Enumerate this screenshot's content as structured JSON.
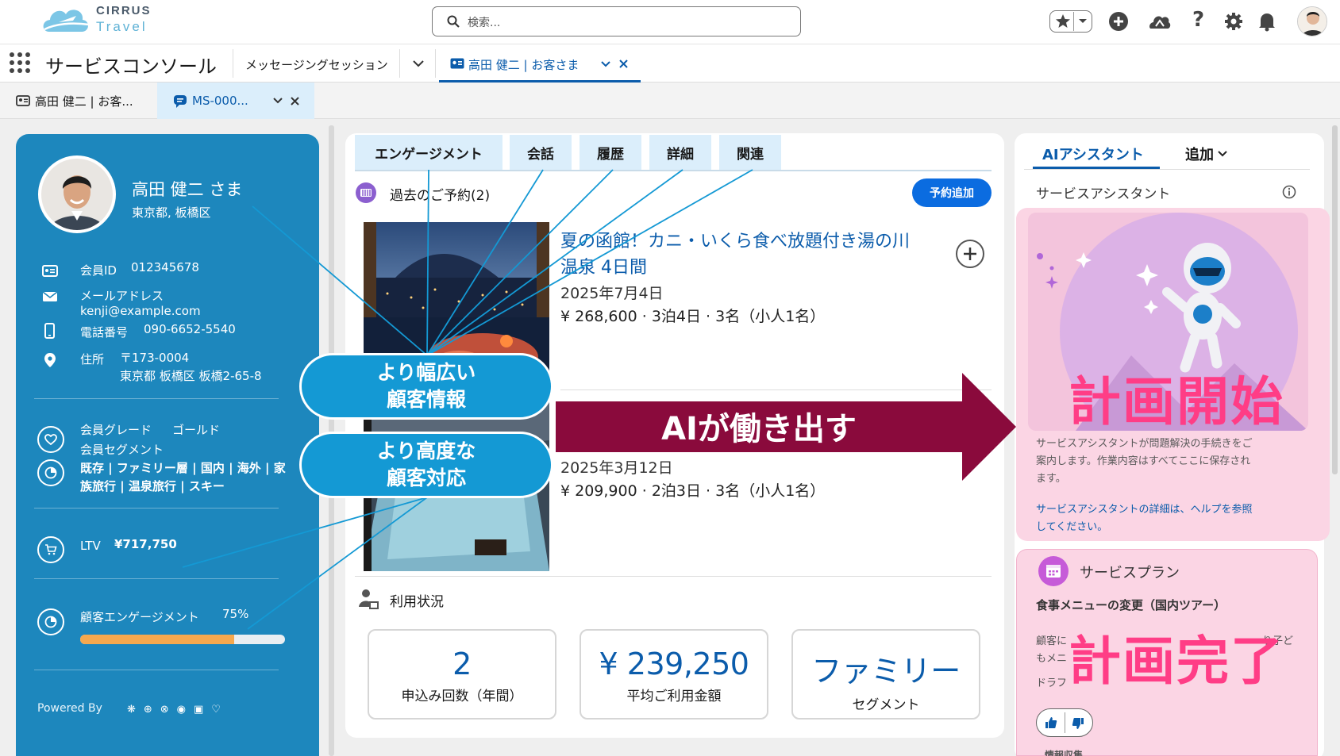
{
  "brand": {
    "line1": "CIRRUS",
    "line2": "Travel"
  },
  "search": {
    "placeholder": "検索..."
  },
  "topbar_icons": [
    "favorites-star-icon",
    "add-icon",
    "trailhead-icon",
    "help-icon",
    "settings-icon",
    "notification-bell-icon",
    "user-avatar"
  ],
  "app": {
    "name": "サービスコンソール"
  },
  "nav_tabs": [
    {
      "label": "メッセージングセッション"
    },
    {
      "label": "高田 健二 | お客さま"
    }
  ],
  "subtabs": [
    {
      "label": "高田 健二 | お客..."
    },
    {
      "label": "MS-000..."
    }
  ],
  "customer": {
    "name": "高田 健二 さま",
    "location": "東京都, 板橋区",
    "member_id_label": "会員ID",
    "member_id": "012345678",
    "email_label": "メールアドレス",
    "email": "kenji@example.com",
    "phone_label": "電話番号",
    "phone": "090-6652-5540",
    "address_label": "住所",
    "postal": "〒173-0004",
    "address": "東京都 板橋区 板橋2-65-8",
    "grade_label": "会員グレード",
    "grade": "ゴールド",
    "segment_label": "会員セグメント",
    "segment_line1": "既存 | ファミリー層 | 国内 | 海外 | 家",
    "segment_line2": "族旅行 | 温泉旅行 | スキー",
    "ltv_label": "LTV",
    "ltv": "¥717,750",
    "engagement_label": "顧客エンゲージメント",
    "engagement": "75%",
    "engagement_value": 0.75,
    "powered_by": "Powered By"
  },
  "main_tabs": [
    "エンゲージメント",
    "会話",
    "履歴",
    "詳細",
    "関連"
  ],
  "bookings": {
    "title": "過去のご予約(2)",
    "add_button": "予約追加",
    "items": [
      {
        "title_line1": "夏の函館！カニ・いくら食べ放題付き湯の川",
        "title_line2": "温泉 4日間",
        "date": "2025年7月4日",
        "detail": "¥ 268,600 · 3泊4日 · 3名（小人1名）"
      },
      {
        "date": "2025年3月12日",
        "detail": "¥ 209,900 · 2泊3日 · 3名（小人1名）"
      }
    ]
  },
  "usage": {
    "title": "利用状況",
    "stats": [
      {
        "value": "2",
        "label": "申込み回数（年間）"
      },
      {
        "value": "¥ 239,250",
        "label": "平均ご利用金額"
      },
      {
        "value": "ファミリー",
        "label": "セグメント"
      }
    ]
  },
  "overlays": {
    "bubble1_l1": "より幅広い",
    "bubble1_l2": "顧客情報",
    "bubble2_l1": "より高度な",
    "bubble2_l2": "顧客対応",
    "arrow": "AIが働き出す",
    "plan_start": "計画開始",
    "plan_done": "計画完了"
  },
  "assistant": {
    "tab_ai": "AIアシスタント",
    "tab_more": "追加",
    "header": "サービスアシスタント",
    "desc1": "サービスアシスタントが問題解決の手続きをご",
    "desc2": "案内します。作業内容はすべてここに保存され",
    "desc3": "ます。",
    "link1": "サービスアシスタントの詳細は、ヘルプを参照",
    "link2": "してください。",
    "plan_title": "サービスプラン",
    "plan_item": "食事メニューの変更（国内ツアー）",
    "plan_frag1": "顧客に",
    "plan_frag1r": "り子ど",
    "plan_frag2": "もメニ",
    "plan_frag3": "ドラフ",
    "info_label": "情報収集"
  },
  "colors": {
    "accent": "#0b5cab",
    "card_blue": "#1d87bd",
    "arrow": "#8a0a3c",
    "pink_text": "#ff3d86",
    "bubble": "#1499d4"
  }
}
